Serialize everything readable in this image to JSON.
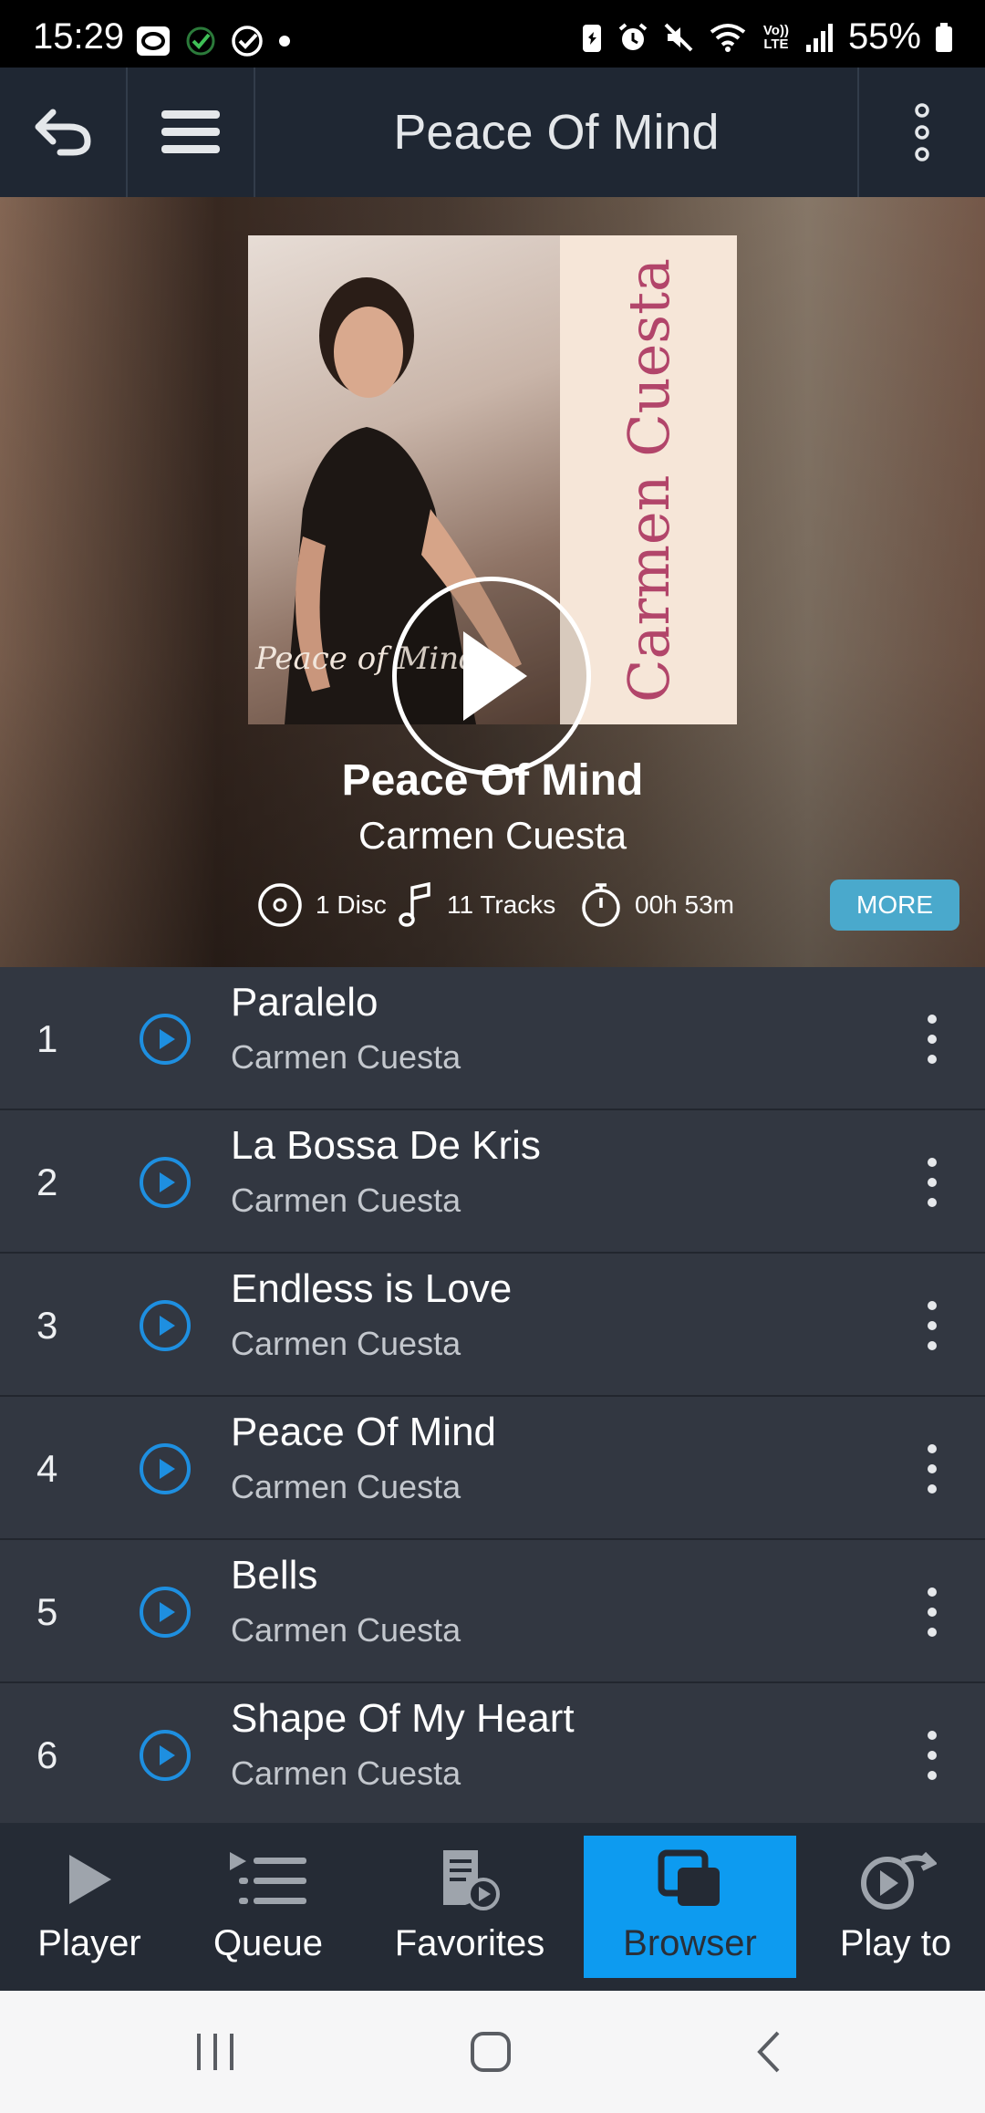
{
  "status_bar": {
    "time": "15:29",
    "battery": "55%",
    "lte_label": "Vo)) LTE"
  },
  "header": {
    "title": "Peace Of Mind"
  },
  "album": {
    "title": "Peace Of Mind",
    "artist": "Carmen Cuesta",
    "cover_artist_text": "Carmen Cuesta",
    "cover_album_text": "Peace of Mind",
    "discs": "1 Disc",
    "tracks": "11 Tracks",
    "duration": "00h 53m",
    "more_label": "MORE"
  },
  "tracks": [
    {
      "num": "1",
      "title": "Paralelo",
      "artist": "Carmen Cuesta"
    },
    {
      "num": "2",
      "title": "La Bossa De Kris",
      "artist": "Carmen Cuesta"
    },
    {
      "num": "3",
      "title": "Endless is Love",
      "artist": "Carmen Cuesta"
    },
    {
      "num": "4",
      "title": "Peace Of Mind",
      "artist": "Carmen Cuesta"
    },
    {
      "num": "5",
      "title": "Bells",
      "artist": "Carmen Cuesta"
    },
    {
      "num": "6",
      "title": "Shape Of My Heart",
      "artist": "Carmen Cuesta"
    }
  ],
  "bottom_nav": [
    {
      "label": "Player",
      "icon": "play-icon"
    },
    {
      "label": "Queue",
      "icon": "queue-icon"
    },
    {
      "label": "Favorites",
      "icon": "favorites-icon"
    },
    {
      "label": "Browser",
      "icon": "browser-icon",
      "active": true
    },
    {
      "label": "Play to",
      "icon": "play-to-icon"
    }
  ],
  "colors": {
    "accent": "#0d9bf0",
    "track_play": "#1e8fe0",
    "more_button": "#4aa9cc"
  }
}
